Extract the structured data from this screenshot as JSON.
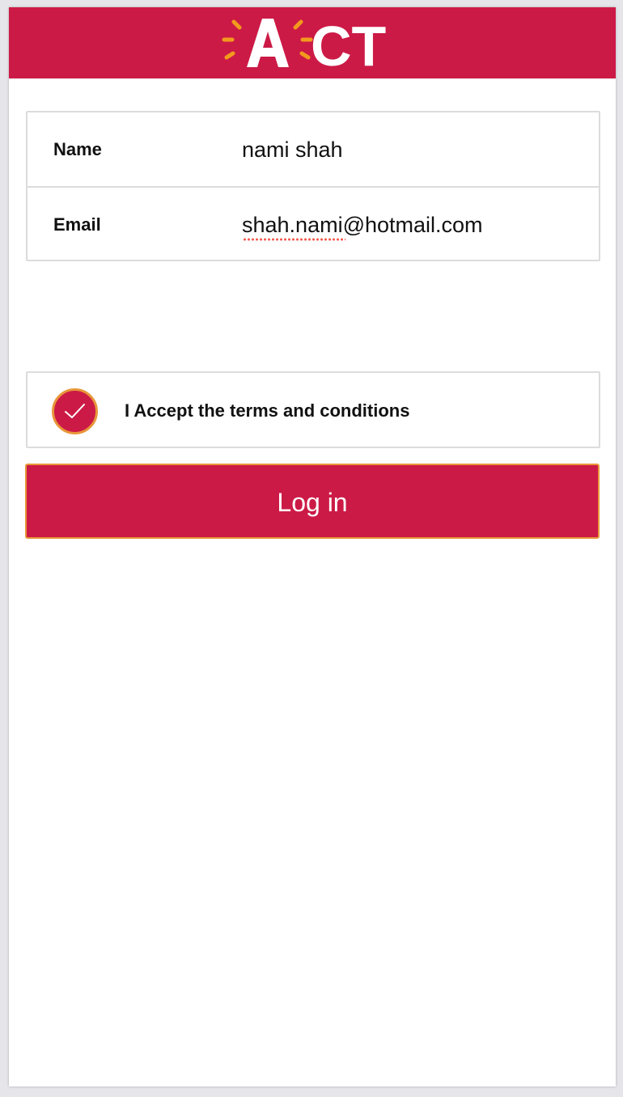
{
  "header": {
    "logo_text": "ACT",
    "background": "#cc1a46",
    "accent": "#f29a1d"
  },
  "form": {
    "name_label": "Name",
    "name_value": "nami shah",
    "email_label": "Email",
    "email_value": "shah.nami@hotmail.com"
  },
  "terms": {
    "checked": true,
    "label": "I Accept the terms and conditions"
  },
  "login_button": {
    "label": "Log in"
  }
}
